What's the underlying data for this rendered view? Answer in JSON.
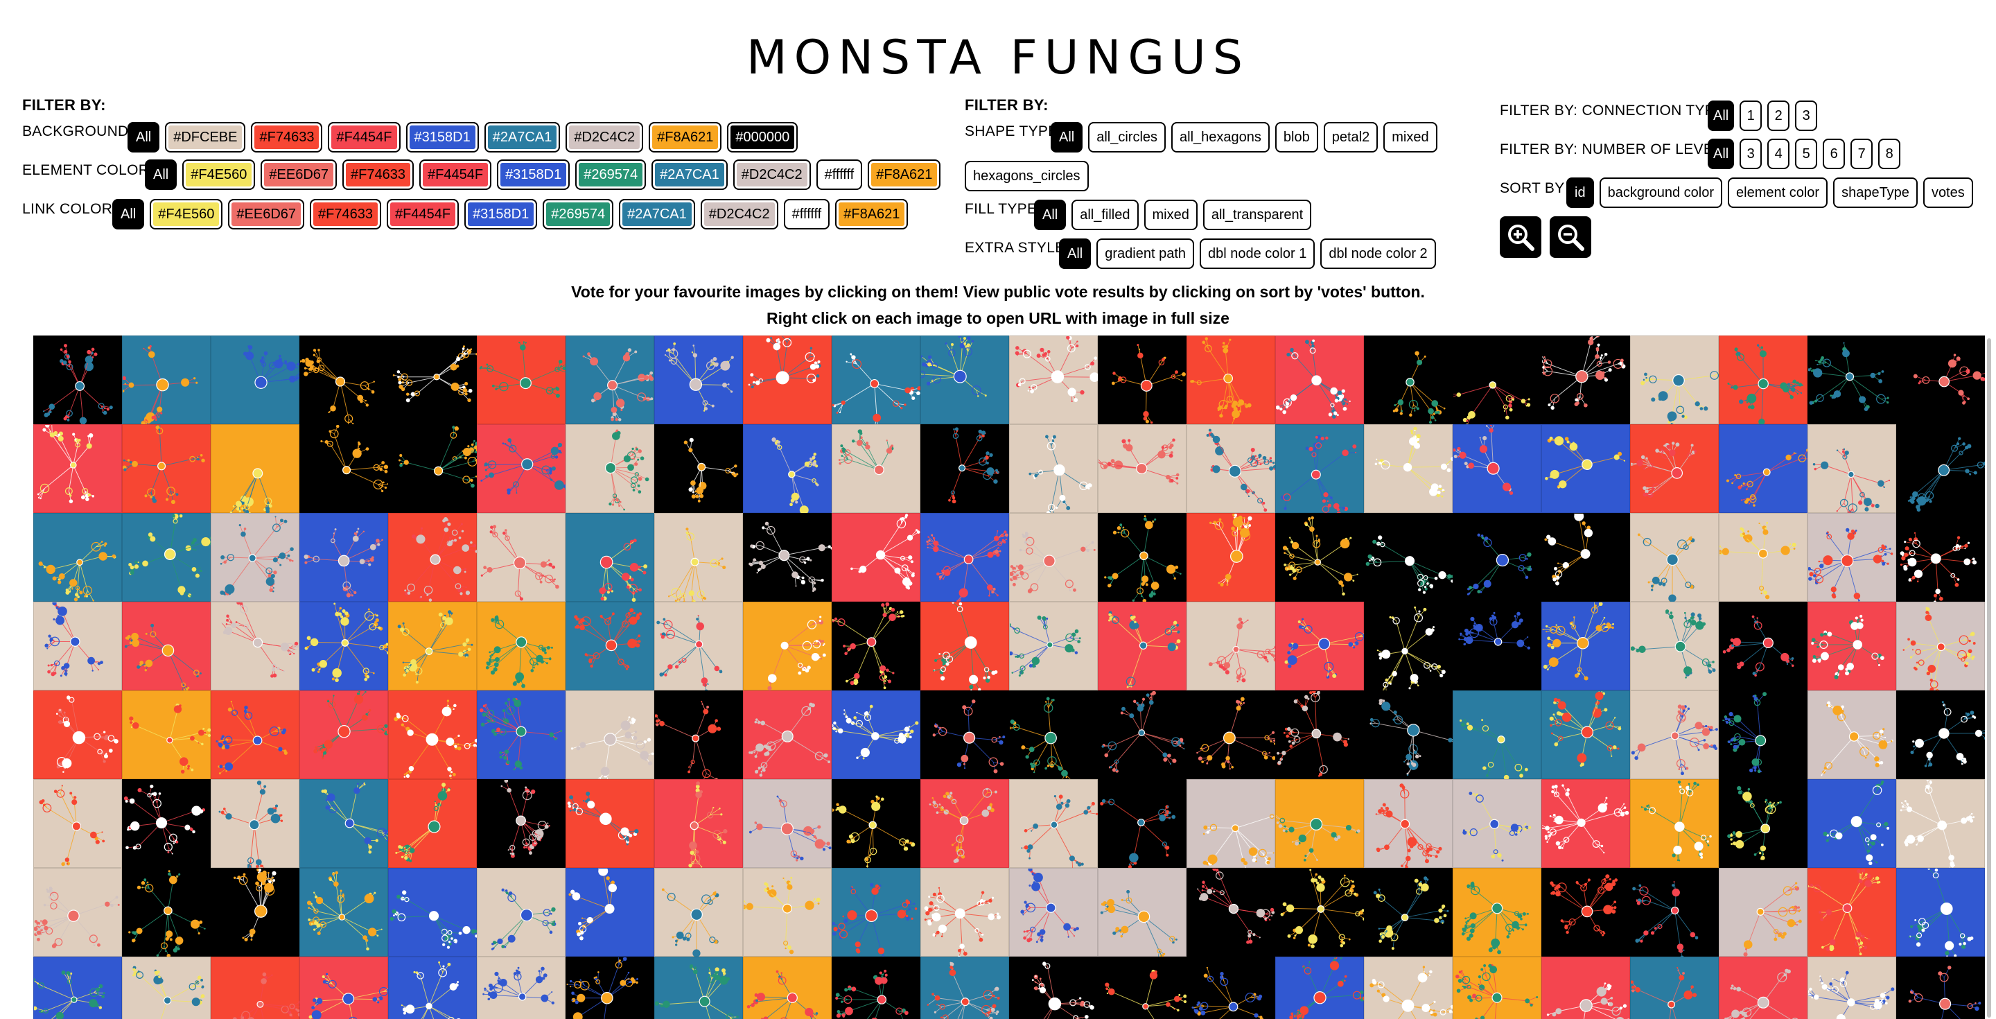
{
  "page_title": "MONSTA FUNGUS",
  "left_filters": {
    "heading": "FILTER BY:",
    "background": {
      "label": "BACKGROUND",
      "options": [
        "All",
        "#DFCEBE",
        "#F74633",
        "#F4454F",
        "#3158D1",
        "#2A7CA1",
        "#D2C4C2",
        "#F8A621",
        "#000000"
      ]
    },
    "element_color": {
      "label": "ELEMENT COLOR",
      "options": [
        "All",
        "#F4E560",
        "#EE6D67",
        "#F74633",
        "#F4454F",
        "#3158D1",
        "#269574",
        "#2A7CA1",
        "#D2C4C2",
        "#ffffff",
        "#F8A621"
      ]
    },
    "link_color": {
      "label": "LINK COLOR",
      "options": [
        "All",
        "#F4E560",
        "#EE6D67",
        "#F74633",
        "#F4454F",
        "#3158D1",
        "#269574",
        "#2A7CA1",
        "#D2C4C2",
        "#ffffff",
        "#F8A621"
      ]
    }
  },
  "middle_filters": {
    "heading": "FILTER BY:",
    "shape_type": {
      "label": "SHAPE TYPE",
      "options": [
        "All",
        "all_circles",
        "all_hexagons",
        "blob",
        "petal2",
        "mixed",
        "hexagons_circles"
      ]
    },
    "fill_type": {
      "label": "FILL TYPE",
      "options": [
        "All",
        "all_filled",
        "mixed",
        "all_transparent"
      ]
    },
    "extra_style": {
      "label": "EXTRA STYLE",
      "options": [
        "All",
        "gradient path",
        "dbl node color 1",
        "dbl node color 2"
      ]
    }
  },
  "right_filters": {
    "connection_type": {
      "label": "FILTER BY: CONNECTION TYPE",
      "options": [
        "All",
        "1",
        "2",
        "3"
      ]
    },
    "levels": {
      "label": "FILTER BY: NUMBER OF LEVELS",
      "options": [
        "All",
        "3",
        "4",
        "5",
        "6",
        "7",
        "8"
      ]
    },
    "sort": {
      "label": "SORT BY",
      "options": [
        "id",
        "background color",
        "element color",
        "shapeType",
        "votes"
      ]
    },
    "zoom_in_icon": "zoom-in-icon",
    "zoom_out_icon": "zoom-out-icon"
  },
  "instructions": [
    "Vote for your favourite images by clicking on them! View public vote results by clicking on sort by 'votes' button.",
    "Right click on each image to open URL with image in full size"
  ],
  "gallery": {
    "columns": 22,
    "tile_backgrounds": [
      "#000000",
      "#2A7CA1",
      "#2A7CA1",
      "#000000",
      "#000000",
      "#F74633",
      "#2A7CA1",
      "#3158D1",
      "#F74633",
      "#2A7CA1",
      "#2A7CA1",
      "#DFCEBE",
      "#000000",
      "#F74633",
      "#F4454F",
      "#000000",
      "#000000",
      "#000000",
      "#DFCEBE",
      "#F74633",
      "#000000",
      "#000000",
      "#F4454F",
      "#F74633",
      "#F8A621",
      "#000000",
      "#000000",
      "#F4454F",
      "#DFCEBE",
      "#000000",
      "#3158D1",
      "#DFCEBE",
      "#000000",
      "#DFCEBE",
      "#DFCEBE",
      "#DFCEBE",
      "#2A7CA1",
      "#DFCEBE",
      "#3158D1",
      "#3158D1",
      "#F74633",
      "#3158D1",
      "#DFCEBE",
      "#000000",
      "#2A7CA1",
      "#2A7CA1",
      "#D2C4C2",
      "#3158D1",
      "#F74633",
      "#DFCEBE",
      "#2A7CA1",
      "#DFCEBE",
      "#000000",
      "#F4454F",
      "#3158D1",
      "#DFCEBE",
      "#000000",
      "#F74633",
      "#000000",
      "#000000",
      "#000000",
      "#000000",
      "#DFCEBE",
      "#DFCEBE",
      "#D2C4C2",
      "#000000",
      "#DFCEBE",
      "#F4454F",
      "#DFCEBE",
      "#3158D1",
      "#F8A621",
      "#F8A621",
      "#2A7CA1",
      "#DFCEBE",
      "#F8A621",
      "#000000",
      "#F74633",
      "#DFCEBE",
      "#F4454F",
      "#DFCEBE",
      "#F4454F",
      "#000000",
      "#000000",
      "#3158D1",
      "#DFCEBE",
      "#000000",
      "#F4454F",
      "#D2C4C2",
      "#F74633",
      "#F8A621",
      "#F74633",
      "#F4454F",
      "#F74633",
      "#3158D1",
      "#DFCEBE",
      "#000000",
      "#F4454F",
      "#3158D1",
      "#000000",
      "#000000",
      "#000000",
      "#000000",
      "#000000",
      "#000000",
      "#2A7CA1",
      "#2A7CA1",
      "#DFCEBE",
      "#000000",
      "#D2C4C2",
      "#000000",
      "#DFCEBE",
      "#000000",
      "#DFCEBE",
      "#2A7CA1",
      "#F74633",
      "#000000",
      "#F74633",
      "#F4454F",
      "#D2C4C2",
      "#000000",
      "#F4454F",
      "#DFCEBE",
      "#000000",
      "#D2C4C2",
      "#F8A621",
      "#D2C4C2",
      "#D2C4C2",
      "#F4454F",
      "#F8A621",
      "#000000",
      "#3158D1",
      "#DFCEBE",
      "#DFCEBE",
      "#000000",
      "#000000",
      "#2A7CA1",
      "#3158D1",
      "#DFCEBE",
      "#3158D1",
      "#DFCEBE",
      "#DFCEBE",
      "#2A7CA1",
      "#DFCEBE",
      "#D2C4C2",
      "#D2C4C2",
      "#000000",
      "#000000",
      "#000000",
      "#F8A621",
      "#000000",
      "#000000",
      "#D2C4C2",
      "#F74633",
      "#3158D1",
      "#3158D1",
      "#DFCEBE",
      "#F74633",
      "#F4454F",
      "#3158D1",
      "#DFCEBE",
      "#000000",
      "#2A7CA1",
      "#F8A621",
      "#000000",
      "#2A7CA1",
      "#000000",
      "#000000",
      "#000000",
      "#3158D1",
      "#DFCEBE",
      "#F8A621",
      "#F4454F",
      "#2A7CA1",
      "#F4454F",
      "#DFCEBE",
      "#000000"
    ],
    "palette": [
      "#F4E560",
      "#EE6D67",
      "#F74633",
      "#F4454F",
      "#3158D1",
      "#269574",
      "#2A7CA1",
      "#D2C4C2",
      "#ffffff",
      "#F8A621"
    ]
  }
}
